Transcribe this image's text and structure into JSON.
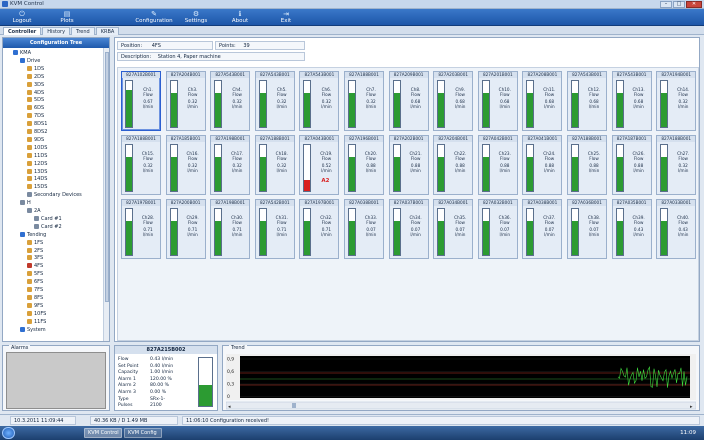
{
  "window": {
    "title": "KVM Control"
  },
  "toolbar": {
    "items": [
      {
        "label": "Logout",
        "icon": "logout-icon",
        "glyph": "⏻"
      },
      {
        "label": "Plots",
        "icon": "plots-icon",
        "glyph": "▤"
      },
      {
        "label": "Configuration",
        "icon": "configuration-icon",
        "glyph": "✎"
      },
      {
        "label": "Settings",
        "icon": "settings-icon",
        "glyph": "⚙"
      },
      {
        "label": "About",
        "icon": "about-icon",
        "glyph": "ℹ"
      },
      {
        "label": "Exit",
        "icon": "exit-icon",
        "glyph": "⇥"
      }
    ]
  },
  "tabs": [
    "Controller",
    "History",
    "Trend",
    "KRBA"
  ],
  "tree": {
    "header": "Configuration Tree",
    "nodes": [
      {
        "label": "KMA",
        "indent": 0,
        "icon": "folder"
      },
      {
        "label": "Drive",
        "indent": 1,
        "icon": "folder"
      },
      {
        "label": "1DS",
        "indent": 2,
        "icon": "dev"
      },
      {
        "label": "2DS",
        "indent": 2,
        "icon": "dev"
      },
      {
        "label": "3DS",
        "indent": 2,
        "icon": "dev"
      },
      {
        "label": "4DS",
        "indent": 2,
        "icon": "dev"
      },
      {
        "label": "5DS",
        "indent": 2,
        "icon": "dev"
      },
      {
        "label": "6DS",
        "indent": 2,
        "icon": "dev"
      },
      {
        "label": "7DS",
        "indent": 2,
        "icon": "dev"
      },
      {
        "label": "8DS1",
        "indent": 2,
        "icon": "dev"
      },
      {
        "label": "8DS2",
        "indent": 2,
        "icon": "dev"
      },
      {
        "label": "9DS",
        "indent": 2,
        "icon": "dev"
      },
      {
        "label": "10DS",
        "indent": 2,
        "icon": "dev"
      },
      {
        "label": "11DS",
        "indent": 2,
        "icon": "dev"
      },
      {
        "label": "12DS",
        "indent": 2,
        "icon": "dev"
      },
      {
        "label": "13DS",
        "indent": 2,
        "icon": "dev"
      },
      {
        "label": "14DS",
        "indent": 2,
        "icon": "dev"
      },
      {
        "label": "15DS",
        "indent": 2,
        "icon": "dev"
      },
      {
        "label": "Secondary Devices",
        "indent": 2,
        "icon": "card"
      },
      {
        "label": "H",
        "indent": 1,
        "icon": "card"
      },
      {
        "label": "2A",
        "indent": 2,
        "icon": "card"
      },
      {
        "label": "Card #1",
        "indent": 3,
        "icon": "card"
      },
      {
        "label": "Card #2",
        "indent": 3,
        "icon": "card"
      },
      {
        "label": "Tending",
        "indent": 1,
        "icon": "folder"
      },
      {
        "label": "1FS",
        "indent": 2,
        "icon": "dev"
      },
      {
        "label": "2FS",
        "indent": 2,
        "icon": "dev"
      },
      {
        "label": "3FS",
        "indent": 2,
        "icon": "dev"
      },
      {
        "label": "4FS",
        "indent": 2,
        "icon": "warn"
      },
      {
        "label": "5FS",
        "indent": 2,
        "icon": "dev"
      },
      {
        "label": "6FS",
        "indent": 2,
        "icon": "dev"
      },
      {
        "label": "7FS",
        "indent": 2,
        "icon": "dev"
      },
      {
        "label": "8FS",
        "indent": 2,
        "icon": "dev"
      },
      {
        "label": "9FS",
        "indent": 2,
        "icon": "dev"
      },
      {
        "label": "10FS",
        "indent": 2,
        "icon": "dev"
      },
      {
        "label": "11FS",
        "indent": 2,
        "icon": "dev"
      },
      {
        "label": "System",
        "indent": 1,
        "icon": "folder"
      }
    ]
  },
  "info": {
    "position_label": "Position:",
    "position_value": "4FS",
    "points_label": "Points:",
    "points_value": "39",
    "description_label": "Description:",
    "description_value": "Station 4, Paper machine"
  },
  "channels": [
    {
      "id": "827A102B001",
      "ch": "Ch1.",
      "type": "Flow",
      "value": "0.67",
      "unit": "l/min",
      "level": 0.8,
      "selected": true
    },
    {
      "id": "827A204B001",
      "ch": "Ch3.",
      "type": "Flow",
      "value": "0.32",
      "unit": "l/min",
      "level": 0.75
    },
    {
      "id": "827A543B001",
      "ch": "Ch4.",
      "type": "Flow",
      "value": "0.32",
      "unit": "l/min",
      "level": 0.75
    },
    {
      "id": "827A543B001",
      "ch": "Ch5.",
      "type": "Flow",
      "value": "0.32",
      "unit": "l/min",
      "level": 0.75
    },
    {
      "id": "827A543B001",
      "ch": "Ch6.",
      "type": "Flow",
      "value": "0.32",
      "unit": "l/min",
      "level": 0.75
    },
    {
      "id": "827A188B001",
      "ch": "Ch7.",
      "type": "Flow",
      "value": "0.32",
      "unit": "l/min",
      "level": 0.75
    },
    {
      "id": "827A209B001",
      "ch": "Ch8.",
      "type": "Flow",
      "value": "0.68",
      "unit": "l/min",
      "level": 0.75
    },
    {
      "id": "827A203B001",
      "ch": "Ch9.",
      "type": "Flow",
      "value": "0.68",
      "unit": "l/min",
      "level": 0.75
    },
    {
      "id": "827A201B001",
      "ch": "Ch10.",
      "type": "Flow",
      "value": "0.68",
      "unit": "l/min",
      "level": 0.75
    },
    {
      "id": "827A208B001",
      "ch": "Ch11.",
      "type": "Flow",
      "value": "0.68",
      "unit": "l/min",
      "level": 0.75
    },
    {
      "id": "827A543B001",
      "ch": "Ch12.",
      "type": "Flow",
      "value": "0.68",
      "unit": "l/min",
      "level": 0.75
    },
    {
      "id": "827A543B001",
      "ch": "Ch13.",
      "type": "Flow",
      "value": "0.68",
      "unit": "l/min",
      "level": 0.75
    },
    {
      "id": "827A194B001",
      "ch": "Ch14.",
      "type": "Flow",
      "value": "0.32",
      "unit": "l/min",
      "level": 0.75
    },
    {
      "id": "827A188B001",
      "ch": "Ch15.",
      "type": "Flow",
      "value": "0.32",
      "unit": "l/min",
      "level": 0.75
    },
    {
      "id": "827A185B001",
      "ch": "Ch16.",
      "type": "Flow",
      "value": "0.32",
      "unit": "l/min",
      "level": 0.75
    },
    {
      "id": "827A198B001",
      "ch": "Ch17.",
      "type": "Flow",
      "value": "0.32",
      "unit": "l/min",
      "level": 0.75
    },
    {
      "id": "827A188B001",
      "ch": "Ch18.",
      "type": "Flow",
      "value": "0.32",
      "unit": "l/min",
      "level": 0.75
    },
    {
      "id": "827A043B001",
      "ch": "Ch19.",
      "type": "Flow",
      "value": "0.52",
      "unit": "l/min",
      "level": 0.25,
      "alarm": "A2"
    },
    {
      "id": "827A196B001",
      "ch": "Ch20.",
      "type": "Flow",
      "value": "0.88",
      "unit": "l/min",
      "level": 0.75
    },
    {
      "id": "827A202B001",
      "ch": "Ch21.",
      "type": "Flow",
      "value": "0.88",
      "unit": "l/min",
      "level": 0.75
    },
    {
      "id": "827A204B001",
      "ch": "Ch22.",
      "type": "Flow",
      "value": "0.88",
      "unit": "l/min",
      "level": 0.75
    },
    {
      "id": "827A042B001",
      "ch": "Ch23.",
      "type": "Flow",
      "value": "0.88",
      "unit": "l/min",
      "level": 0.75
    },
    {
      "id": "827A041B001",
      "ch": "Ch24.",
      "type": "Flow",
      "value": "0.88",
      "unit": "l/min",
      "level": 0.75
    },
    {
      "id": "827A188B001",
      "ch": "Ch25.",
      "type": "Flow",
      "value": "0.88",
      "unit": "l/min",
      "level": 0.75
    },
    {
      "id": "827A187B001",
      "ch": "Ch26.",
      "type": "Flow",
      "value": "0.88",
      "unit": "l/min",
      "level": 0.75
    },
    {
      "id": "827A188B001",
      "ch": "Ch27.",
      "type": "Flow",
      "value": "0.32",
      "unit": "l/min",
      "level": 0.75
    },
    {
      "id": "827A197B001",
      "ch": "Ch28.",
      "type": "Flow",
      "value": "0.71",
      "unit": "l/min",
      "level": 0.75
    },
    {
      "id": "827A200B001",
      "ch": "Ch29.",
      "type": "Flow",
      "value": "0.71",
      "unit": "l/min",
      "level": 0.75
    },
    {
      "id": "827A198B001",
      "ch": "Ch30.",
      "type": "Flow",
      "value": "0.71",
      "unit": "l/min",
      "level": 0.75
    },
    {
      "id": "827A542B001",
      "ch": "Ch31.",
      "type": "Flow",
      "value": "0.71",
      "unit": "l/min",
      "level": 0.75
    },
    {
      "id": "827A197B001",
      "ch": "Ch32.",
      "type": "Flow",
      "value": "0.71",
      "unit": "l/min",
      "level": 0.75
    },
    {
      "id": "827A038B001",
      "ch": "Ch33.",
      "type": "Flow",
      "value": "0.07",
      "unit": "l/min",
      "level": 0.75
    },
    {
      "id": "827A037B001",
      "ch": "Ch34.",
      "type": "Flow",
      "value": "0.07",
      "unit": "l/min",
      "level": 0.75
    },
    {
      "id": "827A034B001",
      "ch": "Ch35.",
      "type": "Flow",
      "value": "0.07",
      "unit": "l/min",
      "level": 0.75
    },
    {
      "id": "827A032B001",
      "ch": "Ch36.",
      "type": "Flow",
      "value": "0.07",
      "unit": "l/min",
      "level": 0.75
    },
    {
      "id": "827A038B001",
      "ch": "Ch37.",
      "type": "Flow",
      "value": "0.07",
      "unit": "l/min",
      "level": 0.75
    },
    {
      "id": "827A036B001",
      "ch": "Ch38.",
      "type": "Flow",
      "value": "0.07",
      "unit": "l/min",
      "level": 0.75
    },
    {
      "id": "827A035B001",
      "ch": "Ch39.",
      "type": "Flow",
      "value": "0.43",
      "unit": "l/min",
      "level": 0.75
    },
    {
      "id": "827A033B001",
      "ch": "Ch40.",
      "type": "Flow",
      "value": "0.43",
      "unit": "l/min",
      "level": 0.75
    }
  ],
  "alarms_panel": {
    "label": "Alarms"
  },
  "detail": {
    "title": "827A215B002",
    "rows": [
      {
        "k": "Flow",
        "v": "0.43 l/min"
      },
      {
        "k": "Set Point",
        "v": "0.40 l/min"
      },
      {
        "k": "Capacity",
        "v": "1.00 l/min"
      },
      {
        "k": "Alarm 1",
        "v": "120.00 %"
      },
      {
        "k": "Alarm 2",
        "v": "80.00 %"
      },
      {
        "k": "Alarm 3",
        "v": "0.00 %"
      },
      {
        "k": "Type",
        "v": "SRx-1-"
      },
      {
        "k": "Pulses",
        "v": "2100"
      }
    ],
    "level": 0.43
  },
  "trend": {
    "label": "Trend",
    "y_ticks": [
      "0,9",
      "0,6",
      "0,3",
      "0"
    ]
  },
  "status": {
    "date": "10.3.2011 11:09:44",
    "metrics": "40.36 KB / D 1.49 MB",
    "message": "11:06:10 Configuration received!"
  },
  "taskbar": {
    "items": [
      "KVM Control",
      "KVM Config"
    ],
    "time": "11:09"
  }
}
